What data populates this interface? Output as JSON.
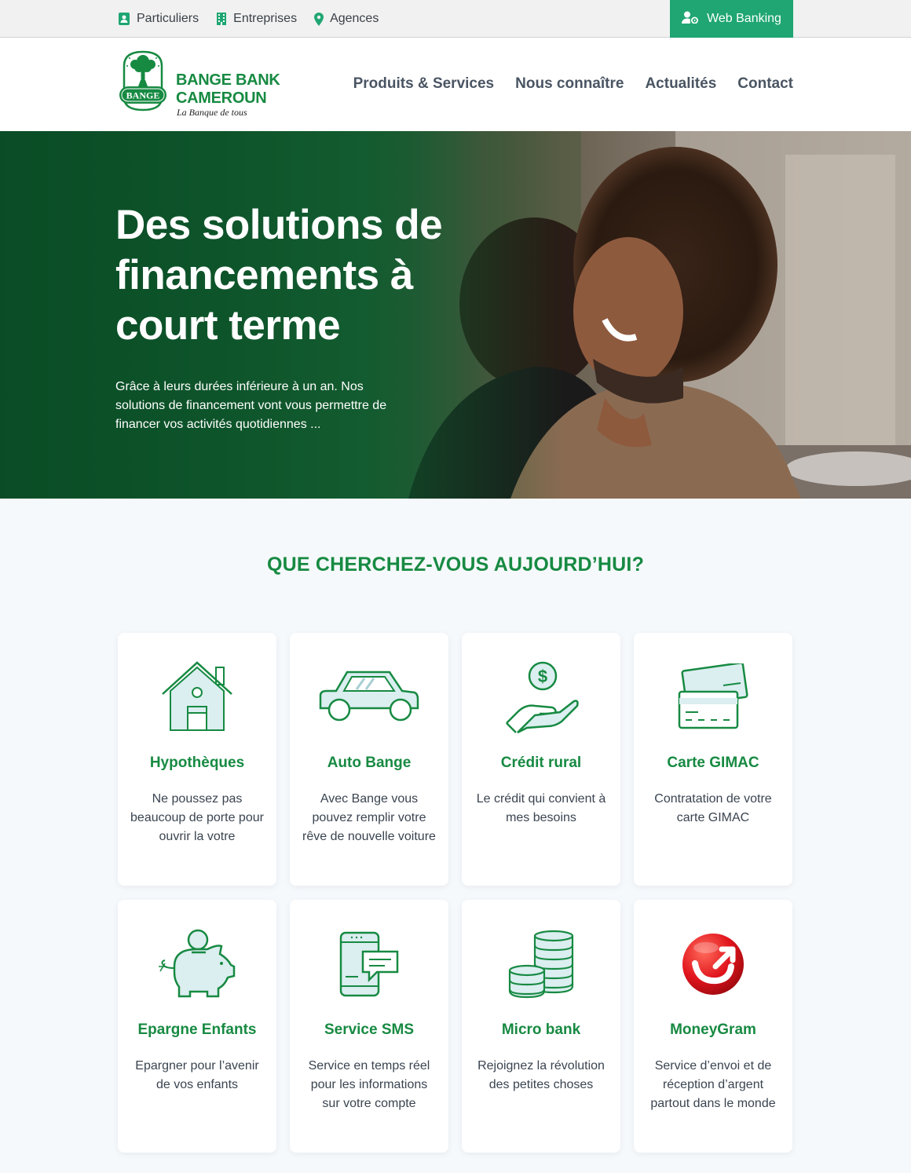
{
  "topbar": {
    "links": [
      {
        "label": "Particuliers",
        "icon": "person-badge-icon"
      },
      {
        "label": "Entreprises",
        "icon": "building-icon"
      },
      {
        "label": "Agences",
        "icon": "map-pin-icon"
      }
    ],
    "web_banking": "Web Banking"
  },
  "brand": {
    "line1": "BANGE BANK",
    "line2": "CAMEROUN",
    "tagline": "La Banque de tous",
    "emblem_text": "BANGE"
  },
  "nav": [
    "Produits & Services",
    "Nous connaître",
    "Actualités",
    "Contact"
  ],
  "hero": {
    "title": "Des solutions de financements à court terme",
    "text": "Grâce à leurs durées inférieure à un an. Nos solutions de financement vont vous permettre de financer vos activités quotidiennes ..."
  },
  "section": {
    "title": "QUE CHERCHEZ-VOUS AUJOURD’HUI?",
    "cards": [
      {
        "title": "Hypothèques",
        "text": "Ne poussez pas beaucoup de porte pour ouvrir la votre",
        "icon": "house-icon"
      },
      {
        "title": "Auto Bange",
        "text": "Avec Bange vous pouvez remplir votre rêve de nouvelle voiture",
        "icon": "car-icon"
      },
      {
        "title": "Crédit rural",
        "text": "Le crédit qui convient à mes besoins",
        "icon": "hand-coin-icon"
      },
      {
        "title": "Carte GIMAC",
        "text": "Contratation de votre carte GIMAC",
        "icon": "cards-icon"
      },
      {
        "title": "Epargne Enfants",
        "text": "Epargner pour l’avenir de vos enfants",
        "icon": "piggy-bank-icon"
      },
      {
        "title": "Service SMS",
        "text": "Service en temps réel pour les informations sur votre compte",
        "icon": "phone-message-icon"
      },
      {
        "title": "Micro bank",
        "text": "Rejoignez la révolution des petites choses",
        "icon": "coin-stack-icon"
      },
      {
        "title": "MoneyGram",
        "text": "Service d’envoi et de réception d’argent partout dans le monde",
        "icon": "moneygram-logo-icon"
      }
    ]
  },
  "colors": {
    "brand_green": "#178a42",
    "button_green": "#1fa672",
    "icon_fill": "#dbeef0"
  }
}
